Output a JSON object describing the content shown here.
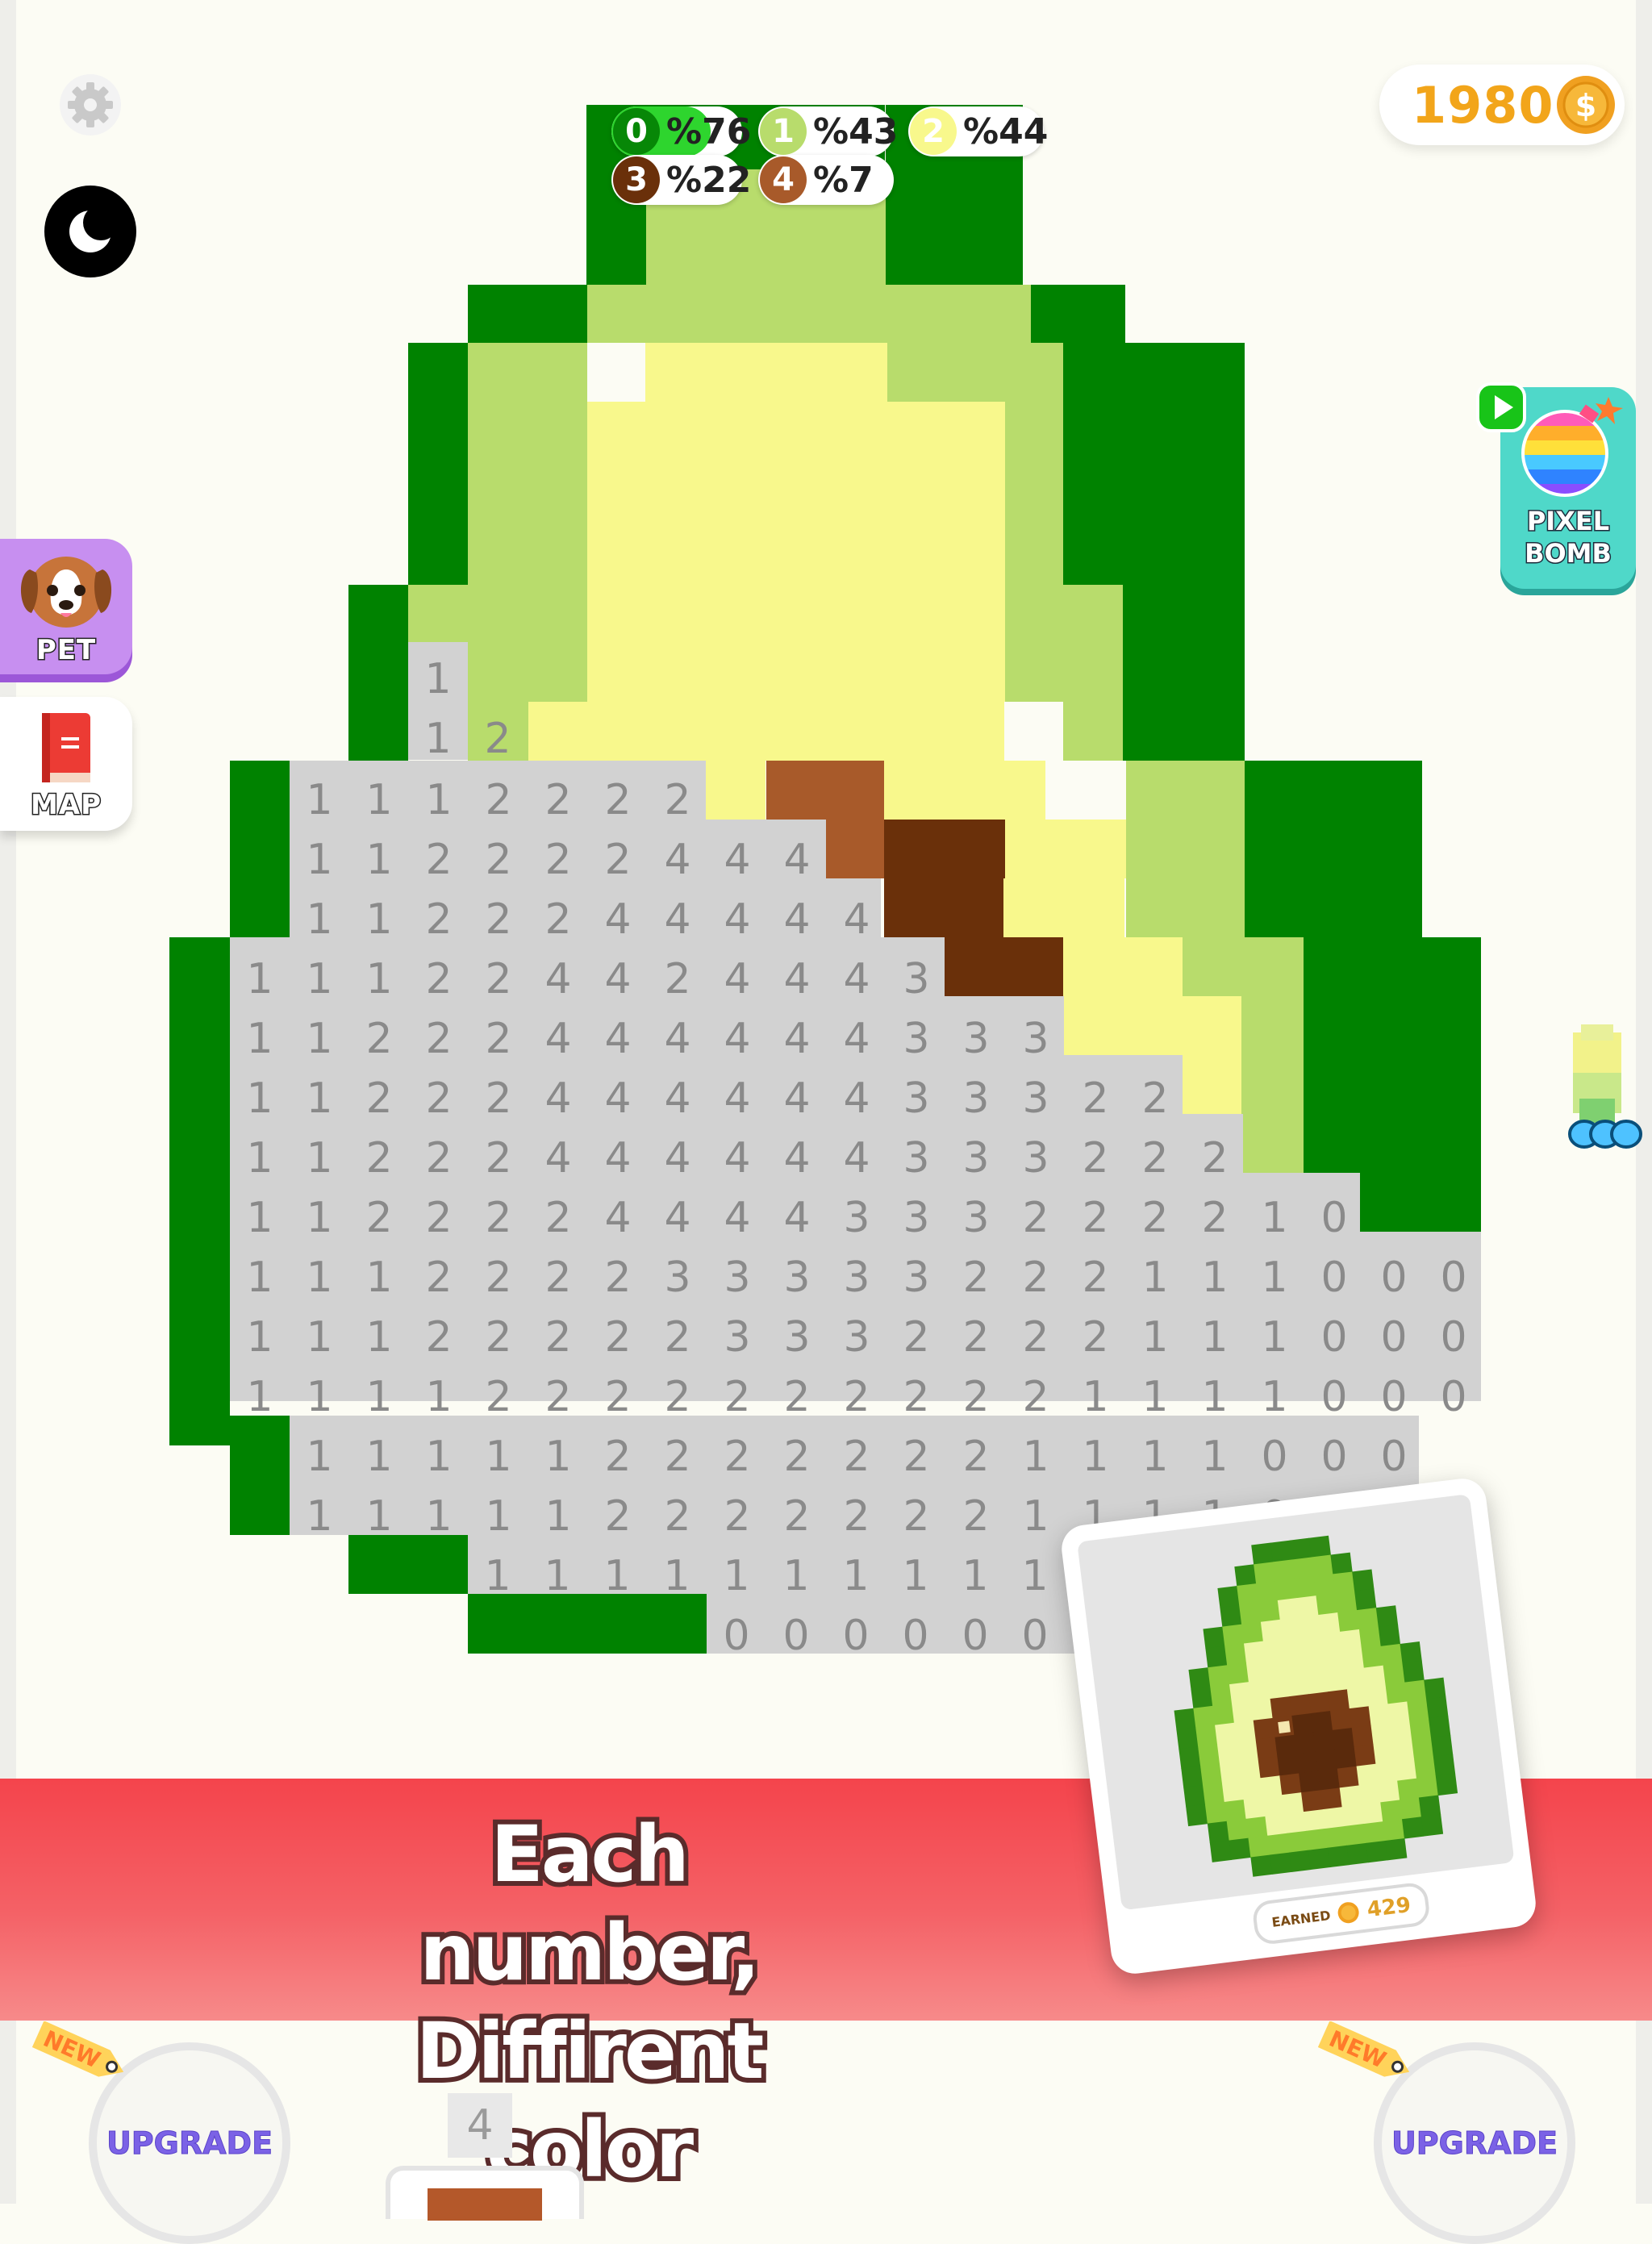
{
  "coins": {
    "count": "1980",
    "icon": "coin-icon"
  },
  "progress": [
    {
      "number": "0",
      "percent": "%76",
      "fraction": 0.76,
      "color": "#078707",
      "text_color": "#ffffff"
    },
    {
      "number": "1",
      "percent": "%43",
      "fraction": 0.43,
      "color": "#b8dc6c",
      "text_color": "#ffffff"
    },
    {
      "number": "2",
      "percent": "%44",
      "fraction": 0.44,
      "color": "#f8f88c",
      "text_color": "#ffffff"
    },
    {
      "number": "3",
      "percent": "%22",
      "fraction": 0.22,
      "color": "#6a300a",
      "text_color": "#ffffff"
    },
    {
      "number": "4",
      "percent": "%7",
      "fraction": 0.07,
      "color": "#a85a2a",
      "text_color": "#ffffff"
    }
  ],
  "side_buttons": {
    "pet": "PET",
    "map": "MAP"
  },
  "powerup": {
    "line1": "PIXEL",
    "line2": "BOMB",
    "color": "#4fd8c9"
  },
  "palette": {
    "0": "#008200",
    "1": "#b8dc6c",
    "2": "#f8f88c",
    "3": "#6a300a",
    "4": "#a85a2a",
    "blank": "#d2d2d2",
    "number_text": "#8a8a8a"
  },
  "pixel_grid": [
    "......XXXXX",
    ".....X33XX...",
    "......X33XXXX3333XXX",
    ".....X33XXXX333XXXX",
    "...XX33XXXXXXX33XXX",
    "...X333XXXXXXX333XX",
    "..XX333XXXXXXX333XXX",
    "..X333XXXXXXXXX3XXXX",
    "..X333XXXXXXXXX3XXXX",
    ".X333XXXXXXXXXXXX3XXX",
    ".X33333XXXXXXXXXX33XX",
    ".X33333XXXXXXXXXXX33XX",
    "XXXXX..XXXXXXXXXXXX3XXX",
    "XXXXX...XXXXXXXXXXXX3XXX",
    "XXXXX...X"
  ],
  "board_rows": [
    {
      "row": 0,
      "cells": "gggggggggg1111gggg1111gggggggg"
    }
  ],
  "board": {
    "rows": [
      "...........000111000........",
      "...........0011111100.......",
      ".........00111111111100.....",
      "........0011222222111000....",
      "........001222222222100.....",
      "........001222222222110.....",
      "........001222222222110.....",
      ".......0011222222222110.....",
      ".......01a2222222222221100..",
      ".......0.ab222222222222110..",
      "....0000bbbbbbb2223322221100",
      "....0bbbbbbbbbbbb22334222100",
      "....0bbbbbbbbbbbbb233322100.",
      "...00bbbbbbbbbbbbbbbb3222100",
      "...00bbbbbbbbbbbbbbbbbb22100",
      "...00bbbbbbbbbbbbbbbbbbbb2100",
      "...00bbbbbbbbbbbbbbbbbbbbb10"
    ]
  },
  "grid_numbers": [
    {
      "r": 11,
      "c": 7,
      "n": "1"
    },
    {
      "r": 12,
      "c": 7,
      "n": "1"
    },
    {
      "r": 12,
      "c": 8,
      "n": "2"
    }
  ],
  "banner": {
    "line1": "Each number,",
    "line2": "Diffirent color"
  },
  "preview": {
    "earned_label": "EARNED",
    "earned_value": "429"
  },
  "bottom": {
    "upgrade_left": "UPGRADE",
    "upgrade_right": "UPGRADE",
    "new_tag": "NEW",
    "tab_number": "4"
  }
}
